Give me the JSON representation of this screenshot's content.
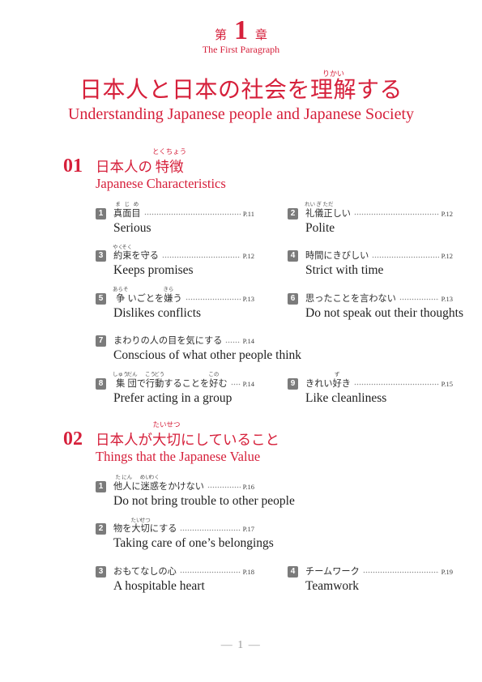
{
  "theme": {
    "accent": "#d6203b",
    "badge": "#7b7b7b"
  },
  "chapter": {
    "prefix": "第",
    "number": "1",
    "suffix": "章",
    "subtitle": "The First Paragraph"
  },
  "title": {
    "jp": [
      {
        "t": "日本人と日本の社会を"
      },
      {
        "t": "理解",
        "r": "りかい"
      },
      {
        "t": "する"
      }
    ],
    "en": "Understanding Japanese people and Japanese Society"
  },
  "sections": [
    {
      "num": "01",
      "heading": [
        {
          "t": "日本人の"
        },
        {
          "t": "特徴",
          "r": "とくちょう"
        }
      ],
      "subheading": "Japanese Characteristics",
      "items": [
        {
          "n": "1",
          "jp": [
            {
              "t": "真",
              "r": "ま"
            },
            {
              "t": "面",
              "r": "じ"
            },
            {
              "t": "目",
              "r": "め"
            }
          ],
          "page": "P.11",
          "en": "Serious"
        },
        {
          "n": "2",
          "jp": [
            {
              "t": "礼",
              "r": "れい"
            },
            {
              "t": "儀",
              "r": "ぎ"
            },
            {
              "t": "正",
              "r": "ただ"
            },
            {
              "t": "しい"
            }
          ],
          "page": "P.12",
          "en": "Polite"
        },
        {
          "n": "3",
          "jp": [
            {
              "t": "約",
              "r": "やく"
            },
            {
              "t": "束",
              "r": "そく"
            },
            {
              "t": "を守る"
            }
          ],
          "page": "P.12",
          "en": "Keeps promises"
        },
        {
          "n": "4",
          "jp": [
            {
              "t": "時間にきびしい"
            }
          ],
          "page": "P.12",
          "en": "Strict with time"
        },
        {
          "n": "5",
          "jp": [
            {
              "t": "争",
              "r": "あらそ"
            },
            {
              "t": "いごとを"
            },
            {
              "t": "嫌",
              "r": "きら"
            },
            {
              "t": "う"
            }
          ],
          "page": "P.13",
          "en": "Dislikes conflicts"
        },
        {
          "n": "6",
          "jp": [
            {
              "t": "思ったことを言わない"
            }
          ],
          "page": "P.13",
          "en": "Do not speak out their thoughts"
        },
        {
          "n": "7",
          "jp": [
            {
              "t": "まわりの人の目を気にする"
            }
          ],
          "page": "P.14",
          "en": "Conscious of what other people think"
        },
        {
          "n": "8",
          "jp": [
            {
              "t": "集",
              "r": "しゅう"
            },
            {
              "t": "団",
              "r": "だん"
            },
            {
              "t": "で"
            },
            {
              "t": "行",
              "r": "こう"
            },
            {
              "t": "動",
              "r": "どう"
            },
            {
              "t": "することを"
            },
            {
              "t": "好",
              "r": "この"
            },
            {
              "t": "む"
            }
          ],
          "page": "P.14",
          "en": "Prefer acting in a group"
        },
        {
          "n": "9",
          "jp": [
            {
              "t": "きれい"
            },
            {
              "t": "好",
              "r": "ず"
            },
            {
              "t": "き"
            }
          ],
          "page": "P.15",
          "en": "Like cleanliness"
        }
      ]
    },
    {
      "num": "02",
      "heading": [
        {
          "t": "日本人が"
        },
        {
          "t": "大切",
          "r": "たいせつ"
        },
        {
          "t": "にしていること"
        }
      ],
      "subheading": "Things that the Japanese Value",
      "items": [
        {
          "n": "1",
          "jp": [
            {
              "t": "他",
              "r": "た"
            },
            {
              "t": "人",
              "r": "にん"
            },
            {
              "t": "に"
            },
            {
              "t": "迷",
              "r": "めい"
            },
            {
              "t": "惑",
              "r": "わく"
            },
            {
              "t": "をかけない"
            }
          ],
          "page": "P.16",
          "en": "Do not bring trouble to other people"
        },
        {
          "n": "2",
          "jp": [
            {
              "t": "物を"
            },
            {
              "t": "大",
              "r": "たい"
            },
            {
              "t": "切",
              "r": "せつ"
            },
            {
              "t": "にする"
            }
          ],
          "page": "P.17",
          "en": "Taking care of one’s belongings"
        },
        {
          "n": "3",
          "jp": [
            {
              "t": "おもてなしの心"
            }
          ],
          "page": "P.18",
          "en": "A hospitable heart"
        },
        {
          "n": "4",
          "jp": [
            {
              "t": "チームワーク"
            }
          ],
          "page": "P.19",
          "en": "Teamwork"
        }
      ]
    }
  ],
  "footer": "— 1 —"
}
